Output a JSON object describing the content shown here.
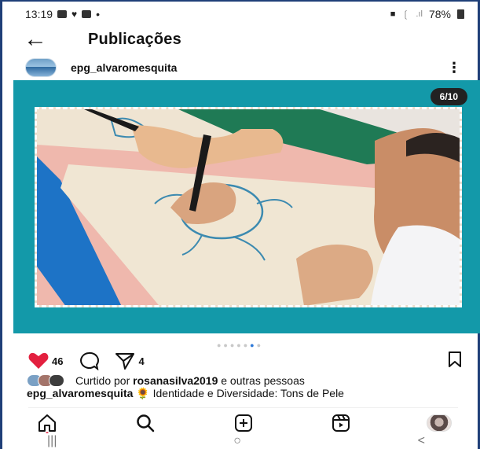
{
  "status_bar": {
    "time": "13:19",
    "battery": "78%",
    "dot": "•"
  },
  "header": {
    "back_glyph": "←",
    "title": "Publicações"
  },
  "post": {
    "username": "epg_alvaromesquita",
    "more_glyph": "⋮",
    "slide_counter": "6/10",
    "like_count": "46",
    "share_count": "4",
    "likes_prefix": "Curtido por",
    "likes_user": "rosanasilva2019",
    "likes_suffix": "e outras pessoas",
    "caption_user": "epg_alvaromesquita",
    "caption_emoji": "🌻",
    "caption_text": "Identidade e Diversidade: Tons de Pele",
    "carousel_current": 6,
    "carousel_total": 10
  },
  "icons": {
    "like": "heart-icon",
    "comment": "comment-icon",
    "share": "send-icon",
    "save": "bookmark-icon"
  },
  "nav": {
    "items": [
      "home-icon",
      "search-icon",
      "new-post-icon",
      "reels-icon",
      "profile-avatar"
    ]
  },
  "system_nav": {
    "recents": "|||",
    "home": "○",
    "back": "<"
  },
  "colors": {
    "media_bg": "#1399a9",
    "heart": "#e3203f",
    "active_dot": "#2f7ad9",
    "frame": "#1f3f78"
  }
}
